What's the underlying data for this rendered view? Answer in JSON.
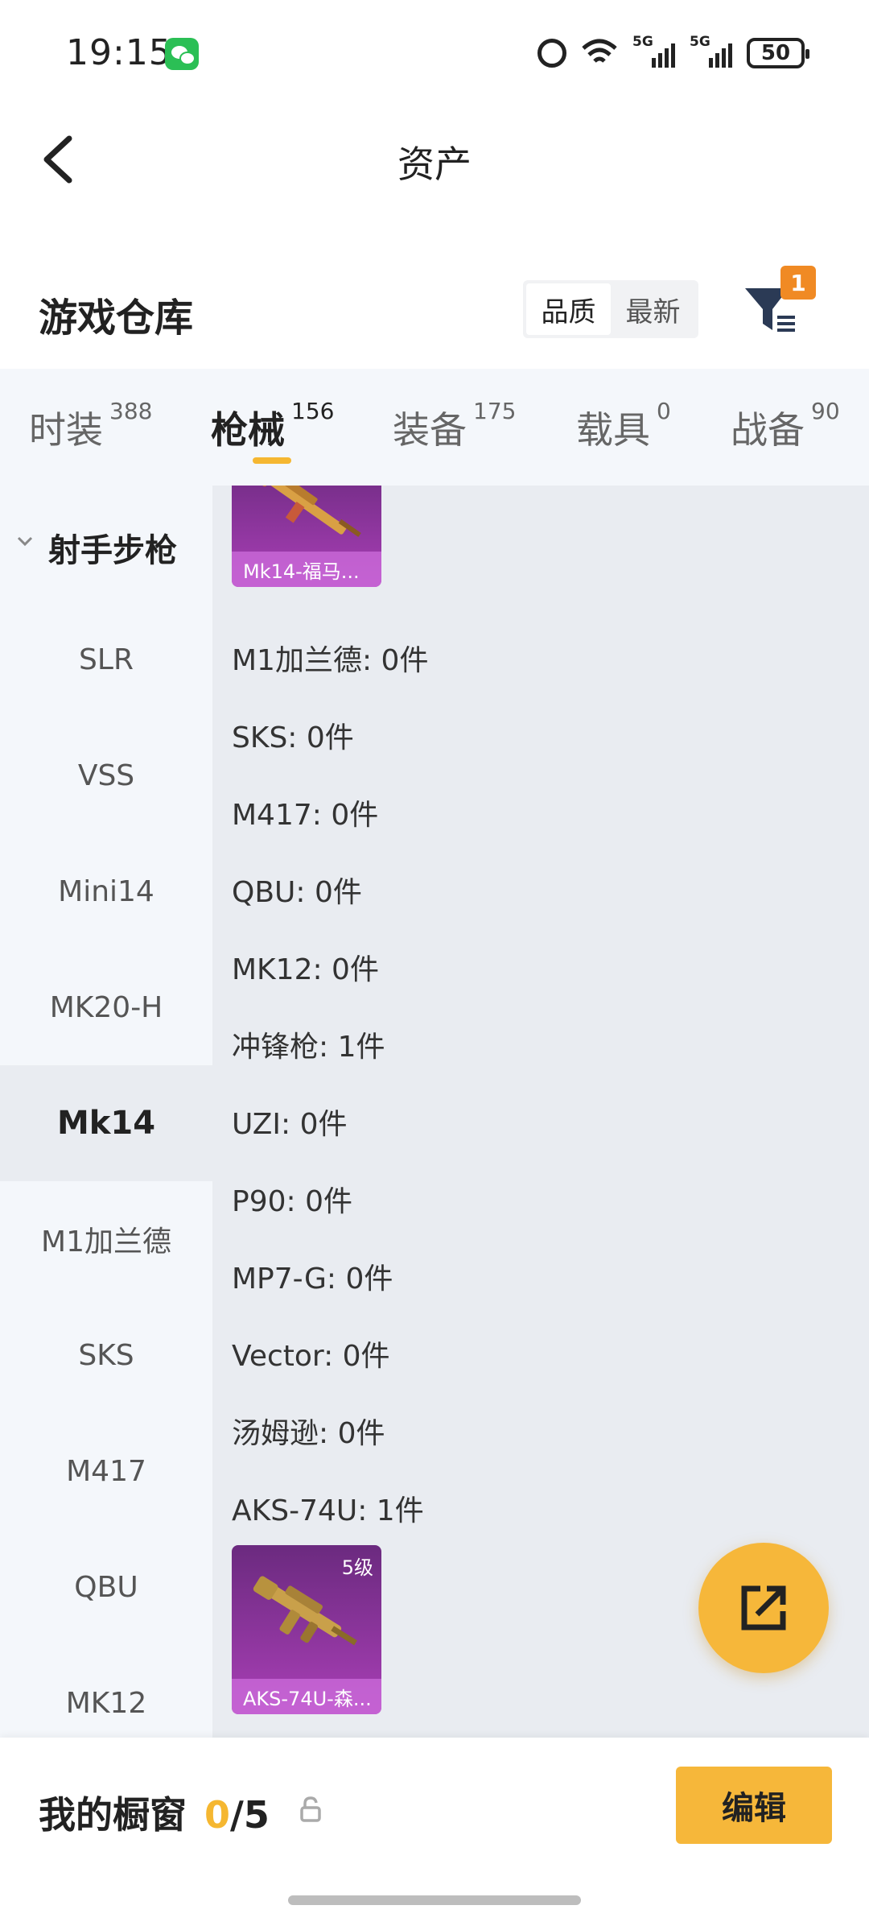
{
  "status_bar": {
    "time": "19:15",
    "signal1_label": "5G",
    "signal2_label": "5G",
    "battery": "50"
  },
  "header": {
    "title": "资产"
  },
  "warehouse": {
    "title": "游戏仓库",
    "sort_options": [
      "品质",
      "最新"
    ],
    "filter_badge": "1"
  },
  "tabs": [
    {
      "label": "时装",
      "count": "388"
    },
    {
      "label": "枪械",
      "count": "156"
    },
    {
      "label": "装备",
      "count": "175"
    },
    {
      "label": "载具",
      "count": "0"
    },
    {
      "label": "战备",
      "count": "90"
    }
  ],
  "sidebar": {
    "group": "射手步枪",
    "items": [
      "SLR",
      "VSS",
      "Mini14",
      "MK20-H",
      "Mk14",
      "M1加兰德",
      "SKS",
      "M417",
      "QBU",
      "MK12"
    ]
  },
  "content": {
    "card_top_caption": "Mk14-福马...",
    "lines": [
      "M1加兰德: 0件",
      "SKS: 0件",
      "M417: 0件",
      "QBU: 0件",
      "MK12: 0件",
      "冲锋枪: 1件",
      "UZI: 0件",
      "P90: 0件",
      "MP7-G: 0件",
      "Vector: 0件",
      "汤姆逊: 0件",
      "AKS-74U: 1件"
    ],
    "card_bottom_caption": "AKS-74U-森...",
    "card_bottom_level": "5级"
  },
  "bottom_bar": {
    "label": "我的橱窗",
    "current": "0",
    "total": "/5",
    "edit_label": "编辑"
  },
  "colors": {
    "accent": "#f6b73a",
    "card_purple": "#a93fb6",
    "badge_orange": "#f08a24"
  }
}
